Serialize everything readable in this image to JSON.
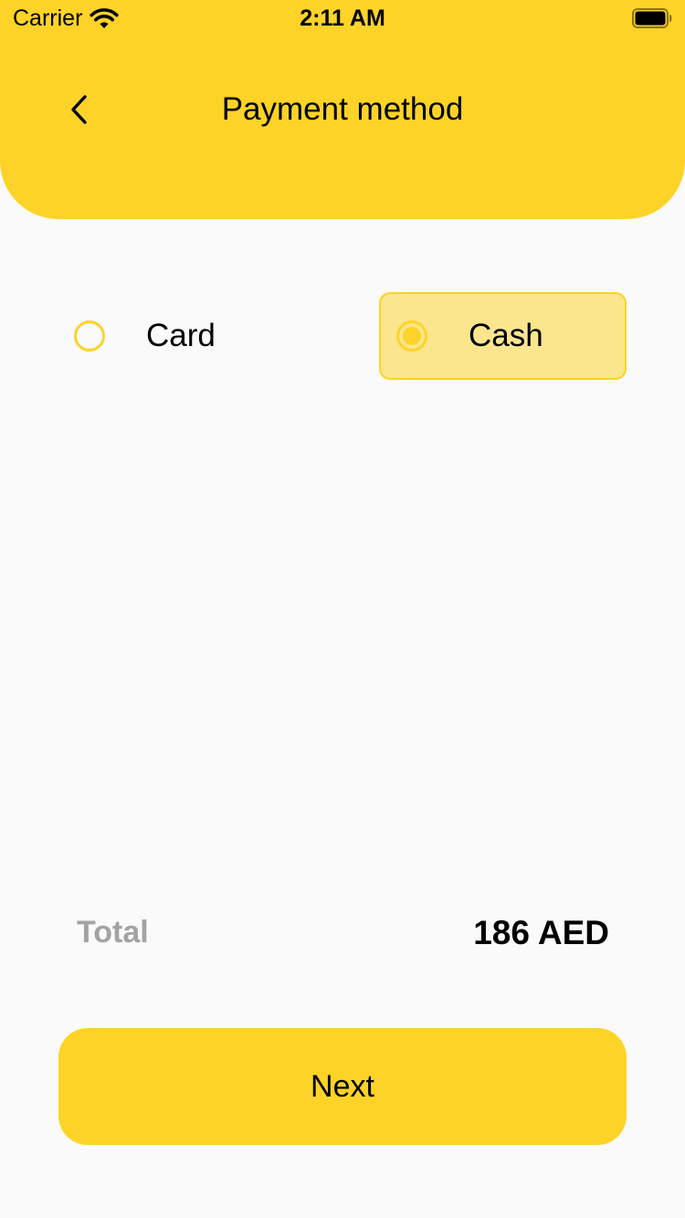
{
  "status_bar": {
    "carrier": "Carrier",
    "time": "2:11 AM",
    "wifi_icon": "wifi-icon",
    "battery_icon": "battery-icon"
  },
  "header": {
    "title": "Payment method",
    "back_icon": "chevron-left-icon"
  },
  "payment_options": [
    {
      "label": "Card",
      "selected": false
    },
    {
      "label": "Cash",
      "selected": true
    }
  ],
  "summary": {
    "total_label": "Total",
    "total_value": "186 AED"
  },
  "actions": {
    "next_label": "Next"
  },
  "colors": {
    "accent": "#fdd327",
    "selected_bg": "#fbe68e",
    "background": "#fafafa",
    "muted_text": "#a3a3a3"
  }
}
